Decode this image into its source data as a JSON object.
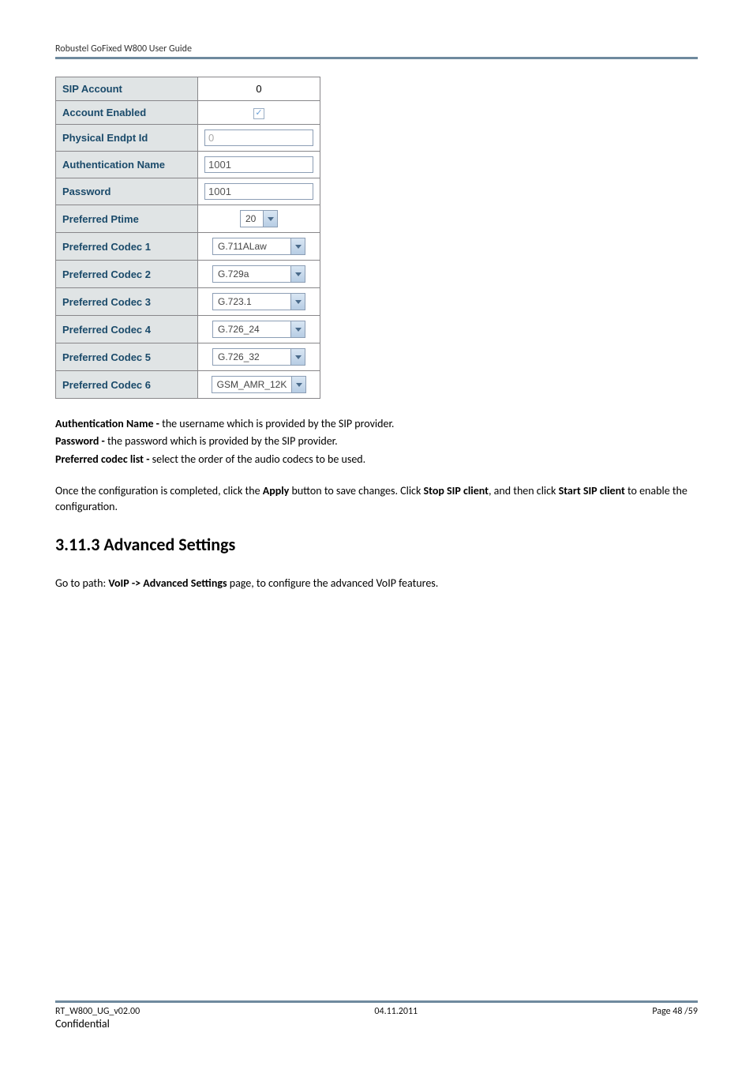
{
  "header": {
    "title": "Robustel GoFixed W800 User Guide"
  },
  "table": {
    "rows": [
      {
        "label": "SIP Account",
        "value": "0",
        "type": "plain-center"
      },
      {
        "label": "Account Enabled",
        "value": "✓",
        "type": "checkbox"
      },
      {
        "label": "Physical Endpt Id",
        "value": "0",
        "type": "input-disabled"
      },
      {
        "label": "Authentication Name",
        "value": "1001",
        "type": "input"
      },
      {
        "label": "Password",
        "value": "1001",
        "type": "input"
      },
      {
        "label": "Preferred Ptime",
        "value": "20",
        "type": "select-narrow"
      },
      {
        "label": "Preferred Codec 1",
        "value": "G.711ALaw",
        "type": "select-wide"
      },
      {
        "label": "Preferred Codec 2",
        "value": "G.729a",
        "type": "select-wide"
      },
      {
        "label": "Preferred Codec 3",
        "value": "G.723.1",
        "type": "select-wide"
      },
      {
        "label": "Preferred Codec 4",
        "value": "G.726_24",
        "type": "select-wide"
      },
      {
        "label": "Preferred Codec 5",
        "value": "G.726_32",
        "type": "select-wide"
      },
      {
        "label": "Preferred Codec 6",
        "value": "GSM_AMR_12K",
        "type": "select-wide"
      }
    ]
  },
  "defs": {
    "auth_bold": "Authentication Name -",
    "auth_rest": " the username which is provided by the SIP provider.",
    "pwd_bold": "Password -",
    "pwd_rest": " the password which is provided by the SIP provider.",
    "codec_bold": "Preferred codec list -",
    "codec_rest": " select the order of the audio codecs to be used."
  },
  "instr": {
    "p1a": "Once the configuration is completed, click the ",
    "p1b": "Apply",
    "p1c": " button to save changes. Click ",
    "p1d": "Stop SIP client",
    "p1e": ", and then click ",
    "p1f": "Start SIP client",
    "p1g": " to enable the configuration."
  },
  "section": {
    "heading": "3.11.3 Advanced Settings"
  },
  "path": {
    "a": "Go to path: ",
    "b": "VoIP -> Advanced Settings",
    "c": " page, to configure the advanced VoIP features."
  },
  "footer": {
    "left1": "RT_W800_UG_v02.00",
    "left2": "Confidential",
    "center": "04.11.2011",
    "right": "Page 48 /59"
  }
}
